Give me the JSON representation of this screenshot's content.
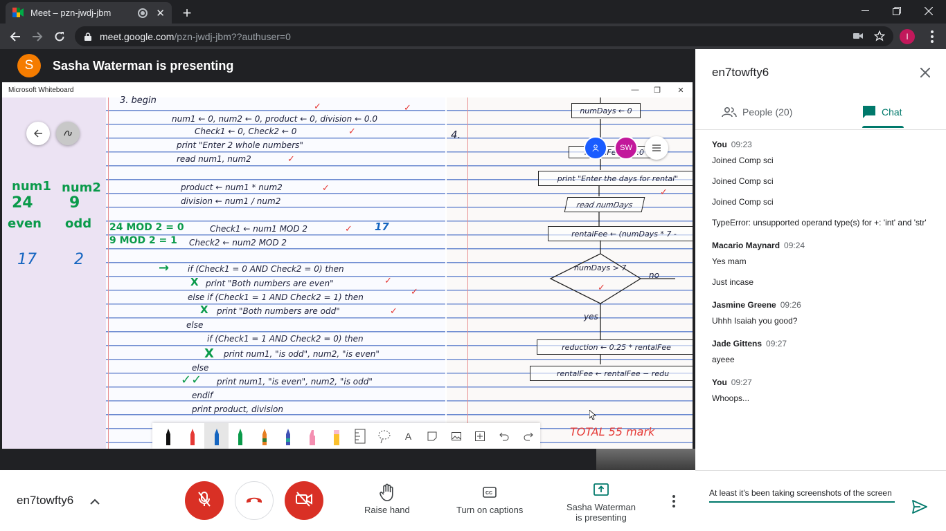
{
  "browser": {
    "tab_title": "Meet – pzn-jwdj-jbm",
    "url_host": "meet.google.com",
    "url_path": "/pzn-jwdj-jbm??authuser=0",
    "profile_initial": "I"
  },
  "stage": {
    "presenter_initial": "S",
    "presenter_text": "Sasha Waterman is presenting",
    "shared_window_title": "Microsoft Whiteboard",
    "whiteboard_avatars": [
      "SW"
    ]
  },
  "whiteboard": {
    "margin_notes": [
      {
        "text": "num1",
        "cls": "hw-green"
      },
      {
        "text": "num2",
        "cls": "hw-green"
      },
      {
        "text": "24",
        "cls": "hw-green"
      },
      {
        "text": "9",
        "cls": "hw-green"
      },
      {
        "text": "even",
        "cls": "hw-green"
      },
      {
        "text": "odd",
        "cls": "hw-green"
      },
      {
        "text": "17",
        "cls": "hw-blue"
      },
      {
        "text": "2",
        "cls": "hw-blue"
      }
    ],
    "page1_lines": [
      "3. begin",
      "num1 ← 0, num2 ← 0, product ← 0, division ← 0.0",
      "Check1 ← 0,   Check2 ← 0",
      "print \"Enter 2 whole numbers\"",
      "read num1, num2",
      "product ← num1 * num2",
      "division ← num1 / num2",
      "Check1 ← num1 MOD 2",
      "Check2 ← num2 MOD 2",
      "if (Check1 = 0 AND Check2 = 0) then",
      "print \"Both numbers are even\"",
      "else  if (Check1 = 1 AND Check2 = 1) then",
      "print \"Both numbers are odd\"",
      "else",
      "if (Check1 = 1  AND  Check2 = 0) then",
      "print num1, \"is odd\", num2, \"is even\"",
      "else",
      "print num1, \"is even\", num2, \"is odd\"",
      "endif",
      "print product, division"
    ],
    "page1_green": [
      "24 MOD 2 = 0",
      "9 MOD 2 = 1",
      "17"
    ],
    "page2": {
      "question_number": "4.",
      "boxes": [
        "numDays ← 0",
        "rentalFee ← 0.0",
        "print \"Enter the days for rental\"",
        "read numDays",
        "rentalFee ← (numDays * 7 -",
        "reduction ← 0.25 * rentalFee",
        "rentalFee ← rentalFee − redu"
      ],
      "decision": "numDays > 7",
      "no_label": "no",
      "yes_label": "yes",
      "total": "TOTAL 55  mark"
    },
    "toolbar_tools": [
      "pen-black-icon",
      "pen-red-icon",
      "pen-blue-icon",
      "pen-green-icon",
      "pen-rainbow-icon",
      "pen-galaxy-icon",
      "highlighter-pink-icon",
      "highlighter-yellow-icon",
      "ruler-icon",
      "lasso-icon",
      "text-icon",
      "sticky-note-icon",
      "image-icon",
      "insert-icon",
      "undo-icon",
      "redo-icon"
    ]
  },
  "panel": {
    "title": "en7towfty6",
    "people_tab": "People (20)",
    "chat_tab": "Chat",
    "messages": [
      {
        "author": "You",
        "time": "09:23",
        "lines": [
          "Joined Comp sci",
          "Joined Comp sci",
          "Joined Comp sci",
          "TypeError: unsupported operand type(s) for +: 'int' and 'str'"
        ]
      },
      {
        "author": "Macario Maynard",
        "time": "09:24",
        "lines": [
          "Yes mam",
          "Just incase"
        ]
      },
      {
        "author": "Jasmine Greene",
        "time": "09:26",
        "lines": [
          "Uhhh Isaiah you good?"
        ]
      },
      {
        "author": "Jade Gittens",
        "time": "09:27",
        "lines": [
          "ayeee"
        ]
      },
      {
        "author": "You",
        "time": "09:27",
        "lines": [
          "Whoops..."
        ]
      }
    ],
    "compose_value": "At least it's been taking screenshots of the screen"
  },
  "controls": {
    "meeting_code": "en7towfty6",
    "raise_hand": "Raise hand",
    "captions": "Turn on captions",
    "presenting": "Sasha Waterman\nis presenting"
  },
  "colors": {
    "meet_red": "#d93025",
    "meet_teal": "#00796b",
    "presenter_orange": "#f57c00"
  }
}
